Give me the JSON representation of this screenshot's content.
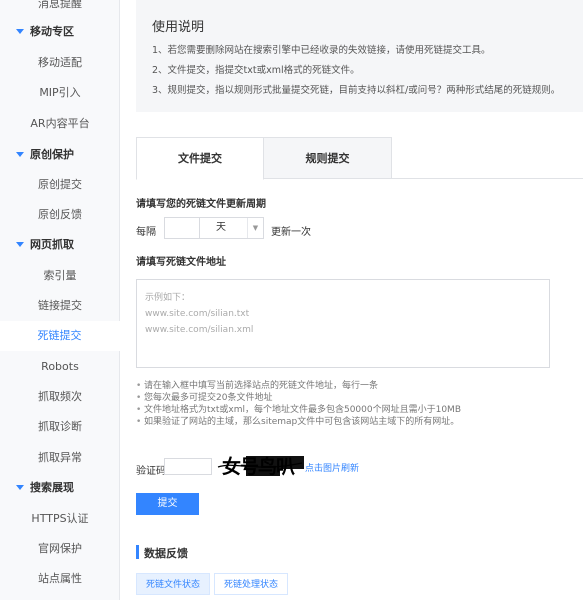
{
  "sidebar": {
    "items": [
      {
        "label": "消息提醒",
        "type": "item"
      },
      {
        "label": "移动专区",
        "type": "group"
      },
      {
        "label": "移动适配",
        "type": "item"
      },
      {
        "label": "MIP引入",
        "type": "item"
      },
      {
        "label": "AR内容平台",
        "type": "item"
      },
      {
        "label": "原创保护",
        "type": "group"
      },
      {
        "label": "原创提交",
        "type": "item"
      },
      {
        "label": "原创反馈",
        "type": "item"
      },
      {
        "label": "网页抓取",
        "type": "group"
      },
      {
        "label": "索引量",
        "type": "item"
      },
      {
        "label": "链接提交",
        "type": "item"
      },
      {
        "label": "死链提交",
        "type": "item",
        "active": true
      },
      {
        "label": "Robots",
        "type": "item"
      },
      {
        "label": "抓取频次",
        "type": "item"
      },
      {
        "label": "抓取诊断",
        "type": "item"
      },
      {
        "label": "抓取异常",
        "type": "item"
      },
      {
        "label": "搜索展现",
        "type": "group"
      },
      {
        "label": "HTTPS认证",
        "type": "item"
      },
      {
        "label": "官网保护",
        "type": "item"
      },
      {
        "label": "站点属性",
        "type": "item"
      }
    ]
  },
  "instructions": {
    "title": "使用说明",
    "lines": [
      "1、若您需要删除网站在搜索引擎中已经收录的失效链接，请使用死链提交工具。",
      "2、文件提交，指提交txt或xml格式的死链文件。",
      "3、规则提交，指以规则形式批量提交死链，目前支持以斜杠/或问号？两种形式结尾的死链规则。"
    ]
  },
  "tabs": {
    "file": "文件提交",
    "rule": "规则提交"
  },
  "form": {
    "period_title": "请填写您的死链文件更新周期",
    "every_label": "每隔",
    "unit_value": "天",
    "update_once": "更新一次",
    "url_title": "请填写死链文件地址",
    "placeholder_lines": [
      "示例如下：",
      "www.site.com/silian.txt",
      "www.site.com/silian.xml"
    ],
    "tips": [
      "请在输入框中填写当前选择站点的死链文件地址，每行一条",
      "您每次最多可提交20条文件地址",
      "文件地址格式为txt或xml，每个地址文件最多包含50000个网址且需小于10MB",
      "如果验证了网站的主域，那么sitemap文件中可包含该网站主域下的所有网址。"
    ],
    "captcha_label": "验证码",
    "captcha_text": "女号鸟叭",
    "captcha_refresh": "点击图片刷新",
    "submit_label": "提交"
  },
  "feedback": {
    "title": "数据反馈",
    "tabs": [
      "死链文件状态",
      "死链处理状态"
    ]
  },
  "colors": {
    "accent": "#3385ff",
    "sidebar_bg": "#f8f9fb",
    "instructions_bg": "#f5f6f8"
  }
}
